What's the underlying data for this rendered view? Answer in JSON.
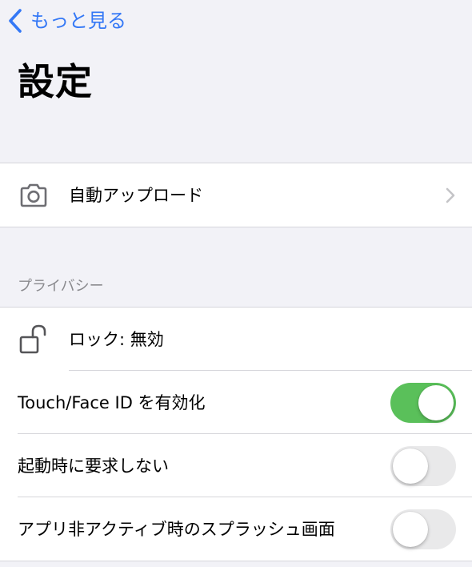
{
  "nav": {
    "back_label": "もっと見る"
  },
  "page_title": "設定",
  "upload_group": {
    "auto_upload_label": "自動アップロード"
  },
  "privacy": {
    "header": "プライバシー",
    "lock_label": "ロック: 無効",
    "touch_face_id_label": "Touch/Face ID を有効化",
    "touch_face_id_on": true,
    "no_request_on_launch_label": "起動時に要求しない",
    "no_request_on_launch_on": false,
    "inactive_splash_label": "アプリ非アクティブ時のスプラッシュ画面",
    "inactive_splash_on": false
  },
  "colors": {
    "accent": "#3478f6",
    "toggle_on": "#5ac05a",
    "toggle_off": "#e9e9ea",
    "background": "#f2f2f7"
  },
  "icons": {
    "back": "chevron-left-icon",
    "camera": "camera-icon",
    "lock": "unlocked-padlock-icon",
    "disclosure": "chevron-right-icon"
  }
}
